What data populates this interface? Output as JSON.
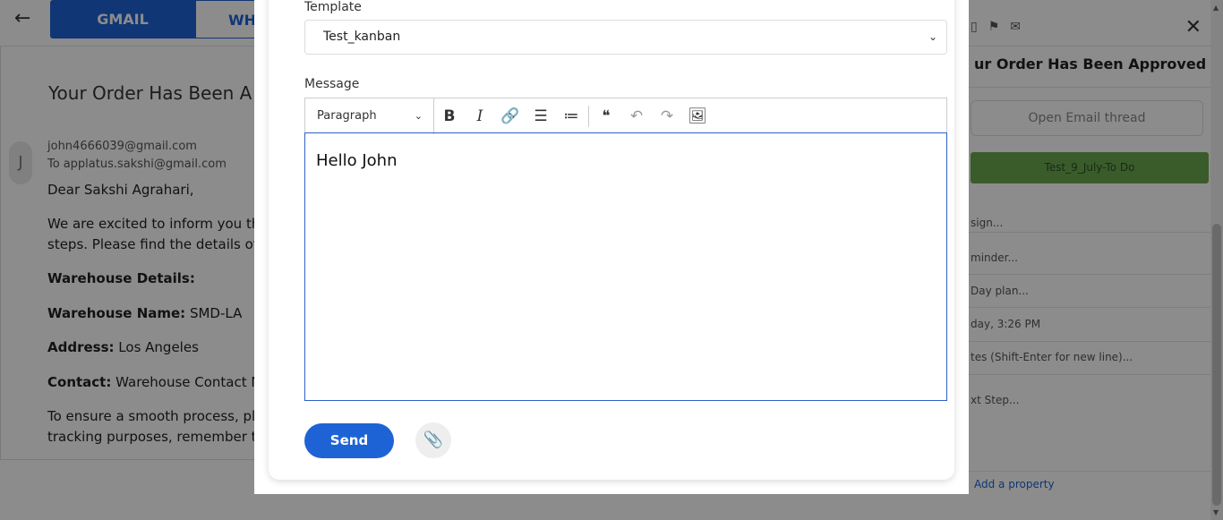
{
  "tabs": {
    "gmail": "GMAIL",
    "whatsapp": "WHA"
  },
  "email": {
    "subject": "Your Order Has Been A",
    "avatar_initial": "J",
    "from": "john4666039@gmail.com",
    "to_label": "To",
    "to": "applatus.sakshi@gmail.com",
    "greeting": "Dear Sakshi Agrahari,",
    "para1_line1": "We are excited to inform you tha",
    "para1_line2": "steps. Please find the details of th",
    "warehouse_details": "Warehouse Details:",
    "warehouse_name_label": "Warehouse Name:",
    "warehouse_name": "SMD-LA",
    "address_label": "Address:",
    "address": "Los Angeles",
    "contact_label": "Contact:",
    "contact": "Warehouse Contact Nu",
    "para2_line1": "To ensure a smooth process, plea",
    "para2_line2": "tracking purposes, remember to"
  },
  "right_panel": {
    "subject": "ur Order Has Been Approved – War",
    "open_thread": "Open Email thread",
    "status": "Test_9_July-To Do",
    "assign": "sign...",
    "reminder": "minder...",
    "day_plan": "Day plan...",
    "date": "day, 3:26 PM",
    "notes": "tes (Shift-Enter for new line)...",
    "next_step": "xt Step...",
    "add_property": "Add a property"
  },
  "modal": {
    "template_label": "Template",
    "template_value": "Test_kanban",
    "message_label": "Message",
    "paragraph_style": "Paragraph",
    "body": "Hello John",
    "send_label": "Send"
  }
}
